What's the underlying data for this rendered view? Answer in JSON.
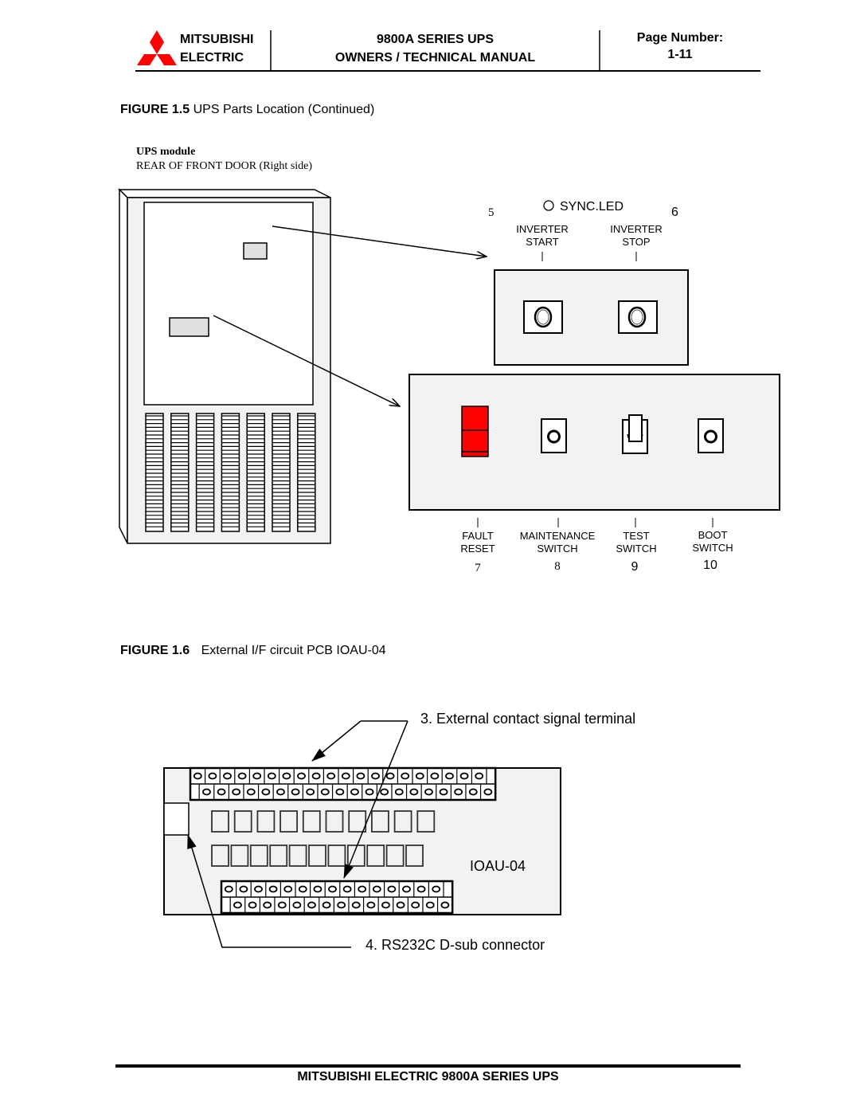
{
  "header": {
    "brand_line1": "MITSUBISHI",
    "brand_line2": "ELECTRIC",
    "title_line1": "9800A SERIES UPS",
    "title_line2": "OWNERS / TECHNICAL MANUAL",
    "page_label": "Page Number:",
    "page_number": "1-11",
    "logo_color": "#ff0000"
  },
  "figure_15": {
    "label": "FIGURE 1.5",
    "title": "UPS Parts Location (Continued)",
    "subtitle_bold": "UPS module",
    "subtitle": "REAR OF FRONT DOOR (Right side)",
    "top_panel": {
      "num_left": "5",
      "num_right": "6",
      "sync_led_label": "SYNC.LED",
      "buttons": [
        {
          "line1": "INVERTER",
          "line2": "START"
        },
        {
          "line1": "INVERTER",
          "line2": "STOP"
        }
      ]
    },
    "bottom_panel": {
      "accent_color": "#ff0000",
      "controls": [
        {
          "line1": "FAULT",
          "line2": "RESET",
          "number": "7"
        },
        {
          "line1": "MAINTENANCE",
          "line2": "SWITCH",
          "number": "8"
        },
        {
          "line1": "TEST",
          "line2": "SWITCH",
          "number": "9"
        },
        {
          "line1": "BOOT",
          "line2": "SWITCH",
          "number": "10"
        }
      ]
    }
  },
  "figure_16": {
    "label": "FIGURE 1.6",
    "title": "External I/F circuit PCB IOAU-04",
    "board_label": "IOAU-04",
    "callout_3": "3. External contact signal terminal",
    "callout_4": "4. RS232C D-sub connector",
    "top_terminal_count_per_row": 20,
    "bottom_terminal_count_per_row": 15,
    "component_row1_count": 10,
    "component_row2_count": 11
  },
  "footer": {
    "text": "MITSUBISHI ELECTRIC 9800A SERIES UPS"
  }
}
